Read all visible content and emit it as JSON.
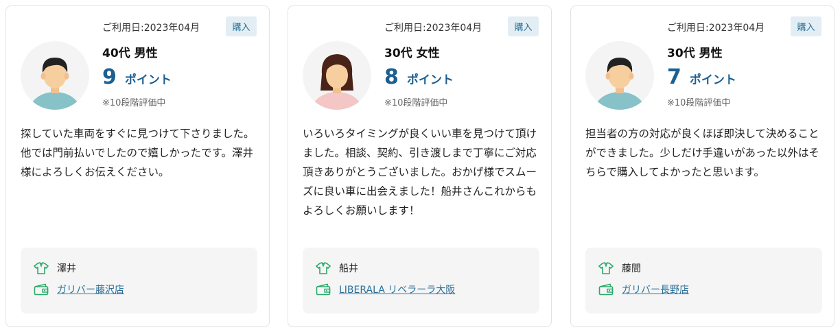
{
  "reviews": [
    {
      "date": "ご利用日:2023年04月",
      "badge": "購入",
      "age_gender": "40代 男性",
      "score": "9",
      "score_unit": "ポイント",
      "scale_note": "※10段階評価中",
      "avatar": "male-avatar",
      "review_text": "探していた車両をすぐに見つけて下さりました。他では門前払いでしたので嬉しかったです。澤井様によろしくお伝えください。",
      "staff_name": "澤井",
      "shop_name": "ガリバー藤沢店"
    },
    {
      "date": "ご利用日:2023年04月",
      "badge": "購入",
      "age_gender": "30代 女性",
      "score": "8",
      "score_unit": "ポイント",
      "scale_note": "※10段階評価中",
      "avatar": "female-avatar",
      "review_text": "いろいろタイミングが良くいい車を見つけて頂けました。相談、契約、引き渡しまで丁寧にご対応頂きありがとうございました。おかげ様でスムーズに良い車に出会えました！船井さんこれからもよろしくお願いします！",
      "staff_name": "船井",
      "shop_name": "LIBERALA リベラーラ大阪"
    },
    {
      "date": "ご利用日:2023年04月",
      "badge": "購入",
      "age_gender": "30代 男性",
      "score": "7",
      "score_unit": "ポイント",
      "scale_note": "※10段階評価中",
      "avatar": "male-avatar",
      "review_text": "担当者の方の対応が良くほぼ即決して決めることができました。少しだけ手違いがあった以外はそちらで購入してよかったと思います。",
      "staff_name": "藤間",
      "shop_name": "ガリバー長野店"
    }
  ],
  "colors": {
    "accent": "#1c5f91",
    "badge_bg": "#e3eef4",
    "icon_green": "#2aa96b",
    "box_bg": "#f5f5f5"
  },
  "icons": {
    "staff": "staff-shirt-icon",
    "shop": "shop-wallet-icon"
  }
}
